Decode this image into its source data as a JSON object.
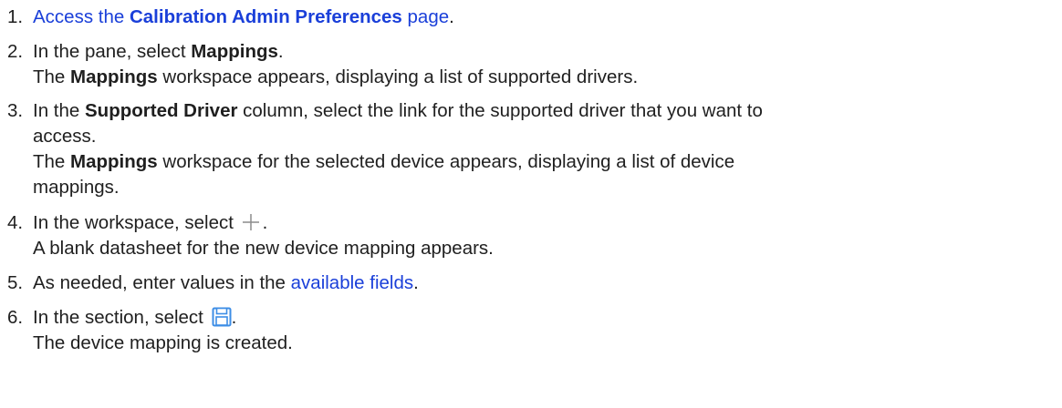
{
  "steps": [
    {
      "number": "1.",
      "link_prefix": "Access the ",
      "link_bold": "Calibration Admin Preferences",
      "link_suffix": " page",
      "after": "."
    },
    {
      "number": "2.",
      "pre": "In the pane, select ",
      "bold": "Mappings",
      "post": ".",
      "result_pre": "The ",
      "result_bold": "Mappings",
      "result_post": " workspace appears, displaying a list of supported drivers."
    },
    {
      "number": "3.",
      "pre": "In the ",
      "bold": "Supported Driver",
      "post_line1": " column, select the link for the supported driver that you want to",
      "post_line2": "access.",
      "result_pre": "The ",
      "result_bold": "Mappings",
      "result_post_line1": " workspace for the selected device appears, displaying a list of device",
      "result_post_line2": "mappings."
    },
    {
      "number": "4.",
      "pre": "In the workspace, select ",
      "icon": "plus-icon",
      "post": ".",
      "result": "A blank datasheet for the new device mapping appears."
    },
    {
      "number": "5.",
      "pre": "As needed, enter values in the ",
      "link": "available fields",
      "post": "."
    },
    {
      "number": "6.",
      "pre": "In the section, select ",
      "icon": "save-icon",
      "post": ".",
      "result": "The device mapping is created."
    }
  ],
  "colors": {
    "text": "#1f1f1f",
    "link": "#1a3fd9",
    "icon_blue": "#3d8ee6",
    "icon_gray": "#8c8c8c"
  }
}
